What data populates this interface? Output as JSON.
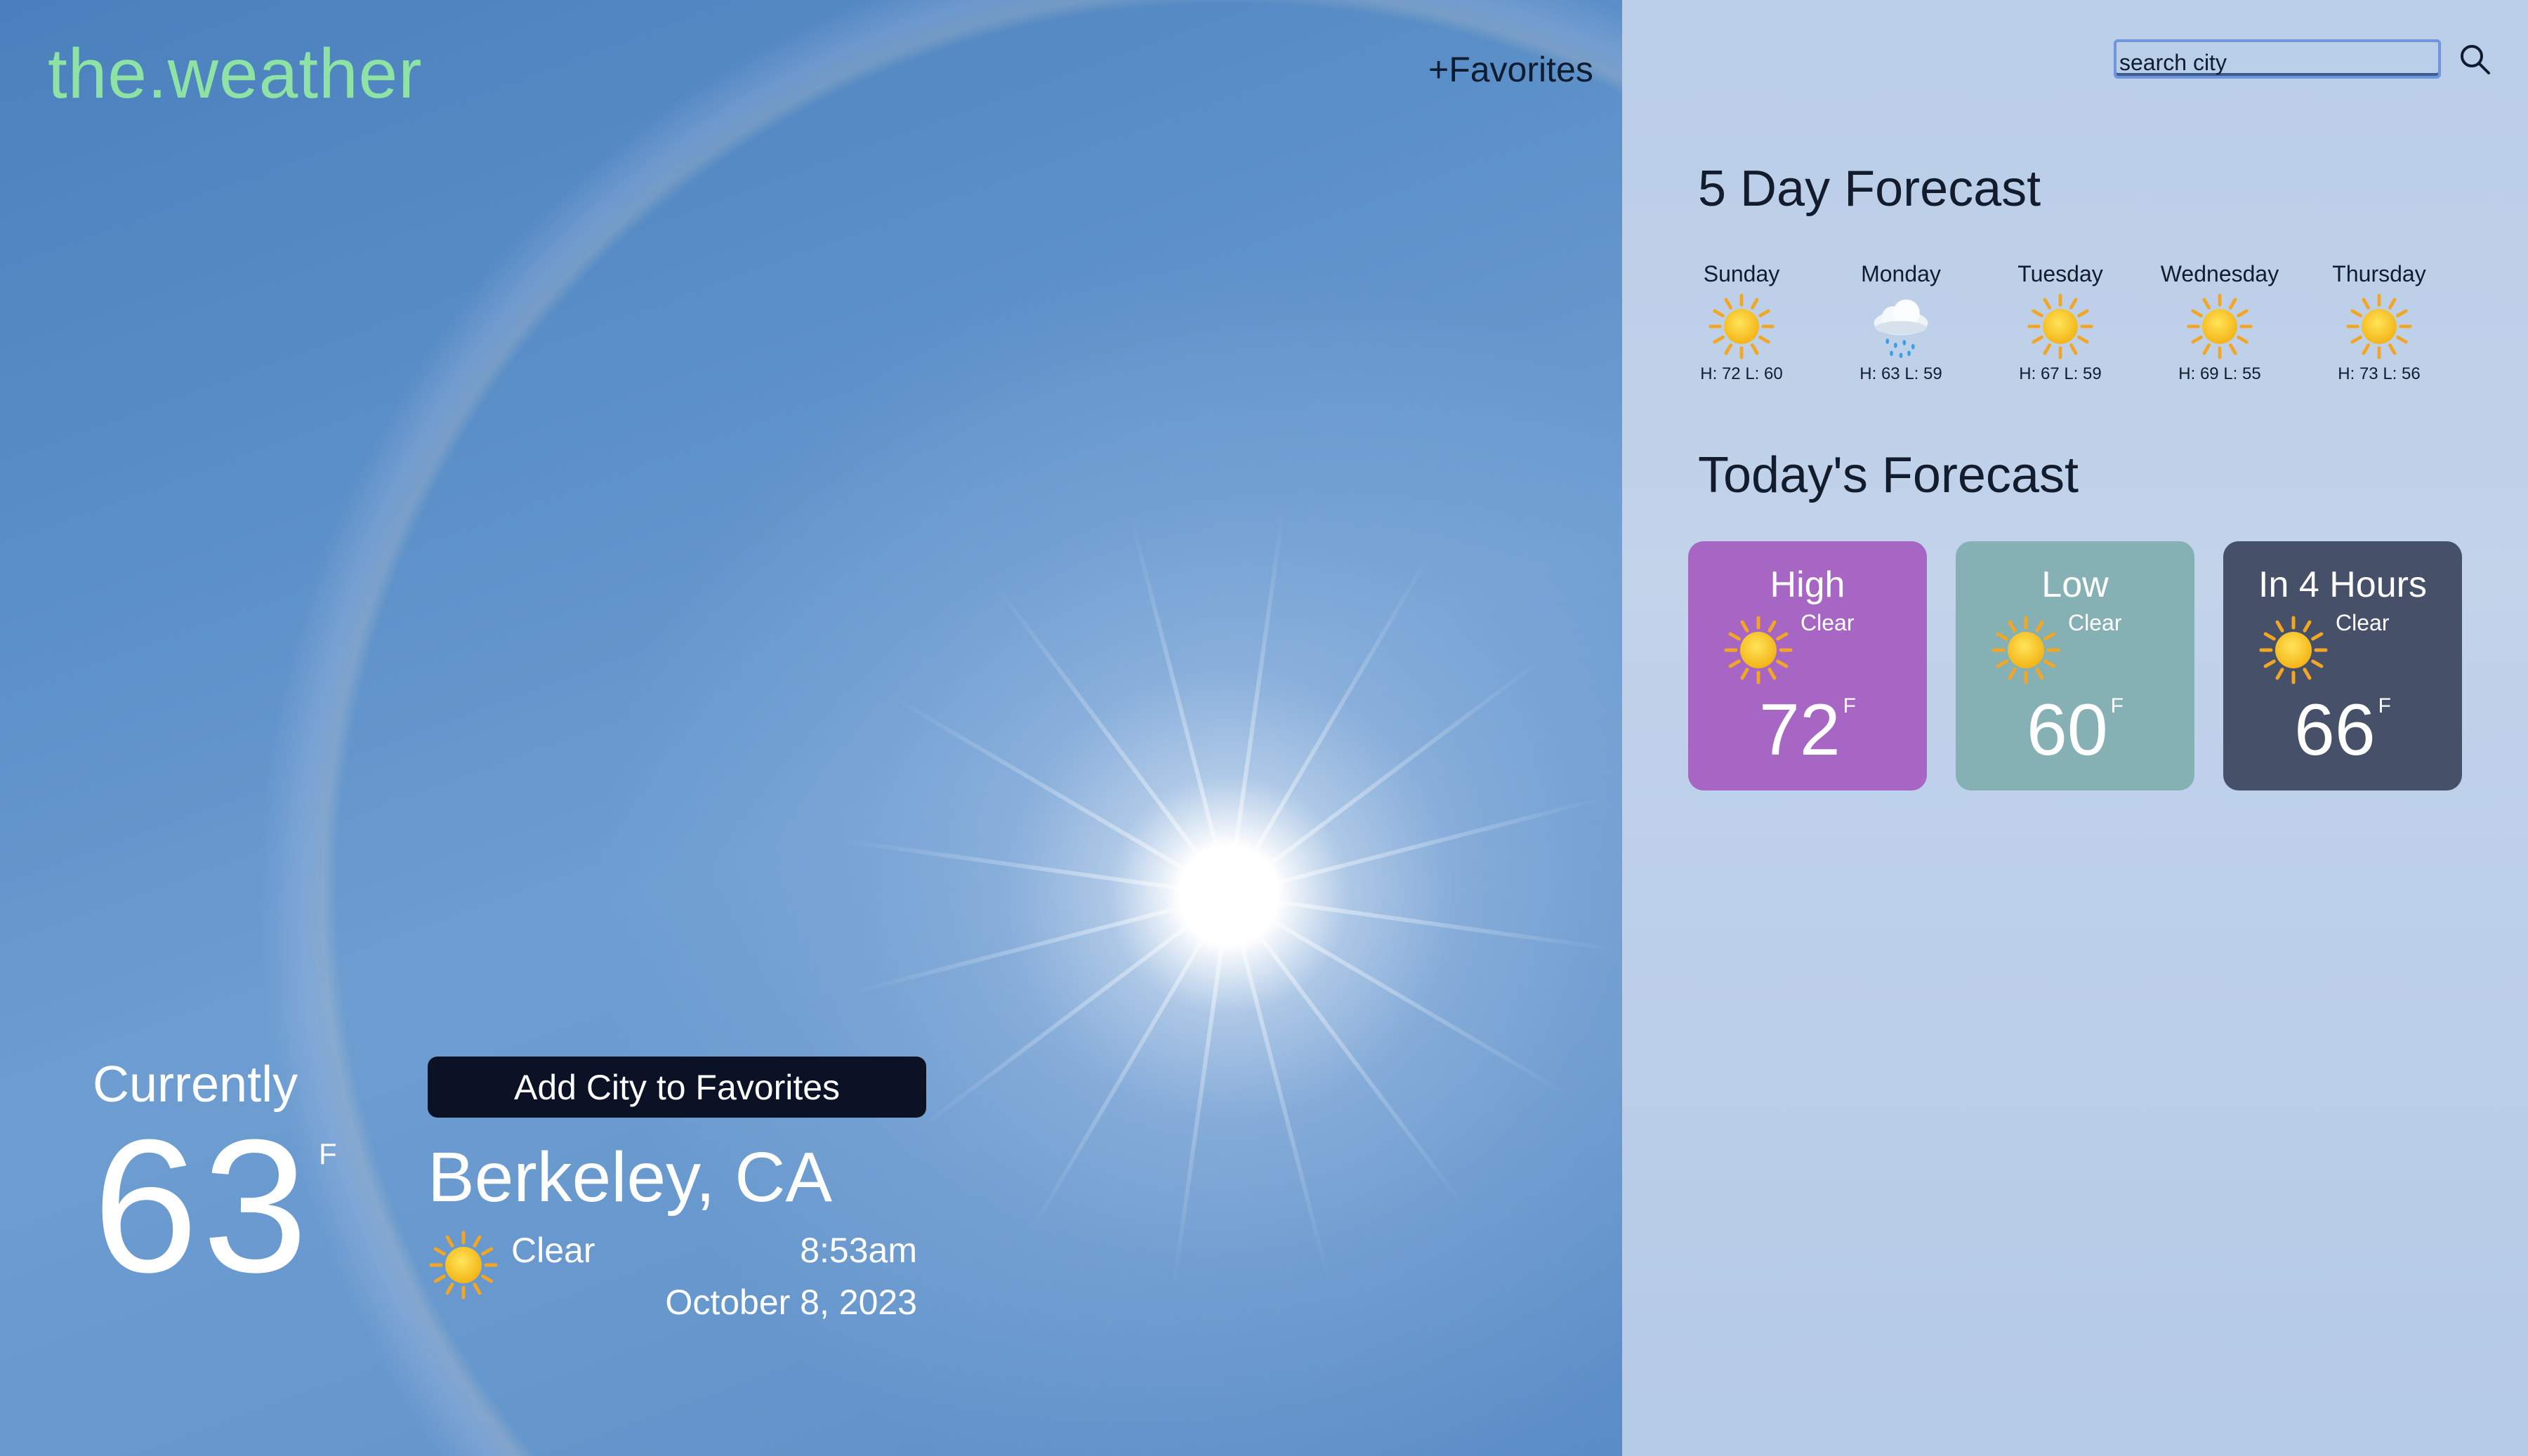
{
  "header": {
    "brand": "the.weather",
    "favorites_link": "+Favorites",
    "search_placeholder": "search city"
  },
  "five_day": {
    "title": "5 Day Forecast",
    "days": [
      {
        "name": "Sunday",
        "icon": "sun-icon",
        "hl": "H: 72 L: 60"
      },
      {
        "name": "Monday",
        "icon": "rain-cloud-icon",
        "hl": "H: 63 L: 59"
      },
      {
        "name": "Tuesday",
        "icon": "sun-icon",
        "hl": "H: 67 L: 59"
      },
      {
        "name": "Wednesday",
        "icon": "sun-icon",
        "hl": "H: 69 L: 55"
      },
      {
        "name": "Thursday",
        "icon": "sun-icon",
        "hl": "H: 73 L: 56"
      }
    ]
  },
  "today": {
    "title": "Today's Forecast",
    "cards": [
      {
        "title": "High",
        "cond": "Clear",
        "temp": "72",
        "unit": "F",
        "color": "#a766c4"
      },
      {
        "title": "Low",
        "cond": "Clear",
        "temp": "60",
        "unit": "F",
        "color": "#86b1b4"
      },
      {
        "title": "In 4 Hours",
        "cond": "Clear",
        "temp": "66",
        "unit": "F",
        "color": "#465068"
      }
    ]
  },
  "current": {
    "label": "Currently",
    "temp": "63",
    "unit": "F",
    "add_button": "Add City to Favorites",
    "city": "Berkeley, CA",
    "cond": "Clear",
    "time": "8:53am",
    "date": "October 8, 2023"
  }
}
